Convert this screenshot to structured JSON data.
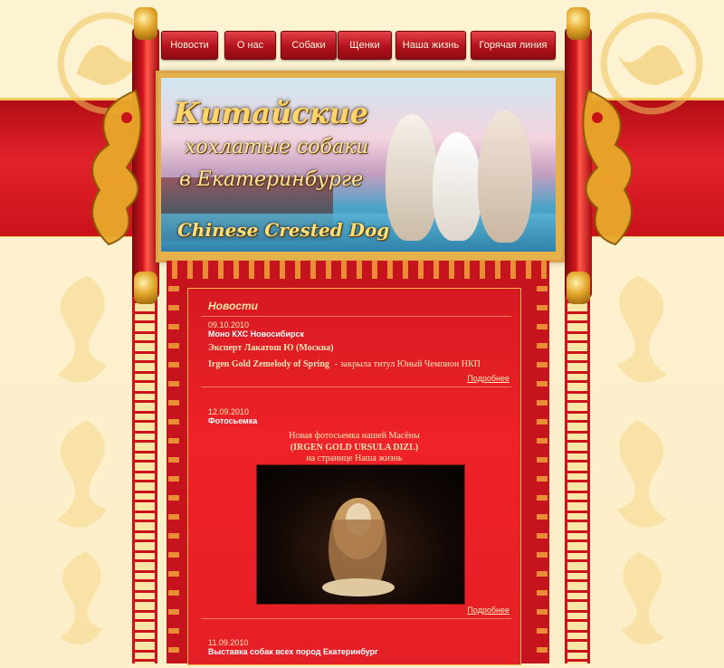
{
  "nav": {
    "items": [
      "Новости",
      "О нас",
      "Собаки",
      "Щенки",
      "Наша жизнь",
      "Горячая линия"
    ]
  },
  "banner": {
    "title_line1": "Китайские",
    "title_line2": "хохлатые собаки",
    "title_line3": "в Екатеринбурге",
    "title_en": "Chinese Crested Dog"
  },
  "news": {
    "section_title": "Новости",
    "more_label": "Подробнее",
    "items": [
      {
        "date": "09.10.2010",
        "headline": "Моно КХС Новосибирск",
        "line1": "Эксперт Лакатош Ю (Москва)",
        "line2_bold": "Irgen Gold Zemelody of Spring",
        "line2_rest": "- закрыла титул Юный Чемпион НКП"
      },
      {
        "date": "12.09.2010",
        "headline": "Фотосьемка",
        "line1": "Новая фотосьемка нашей Масёны",
        "line2": "(IRGEN GOLD URSULA DIZL)",
        "line3": "на странице Наша жизнь"
      },
      {
        "date": "11.09.2010",
        "headline": "Выставка собак всех пород Екатеринбург"
      }
    ]
  },
  "colors": {
    "accent_red": "#e3222b",
    "gold": "#f0b848",
    "cream": "#fdf0c8"
  }
}
